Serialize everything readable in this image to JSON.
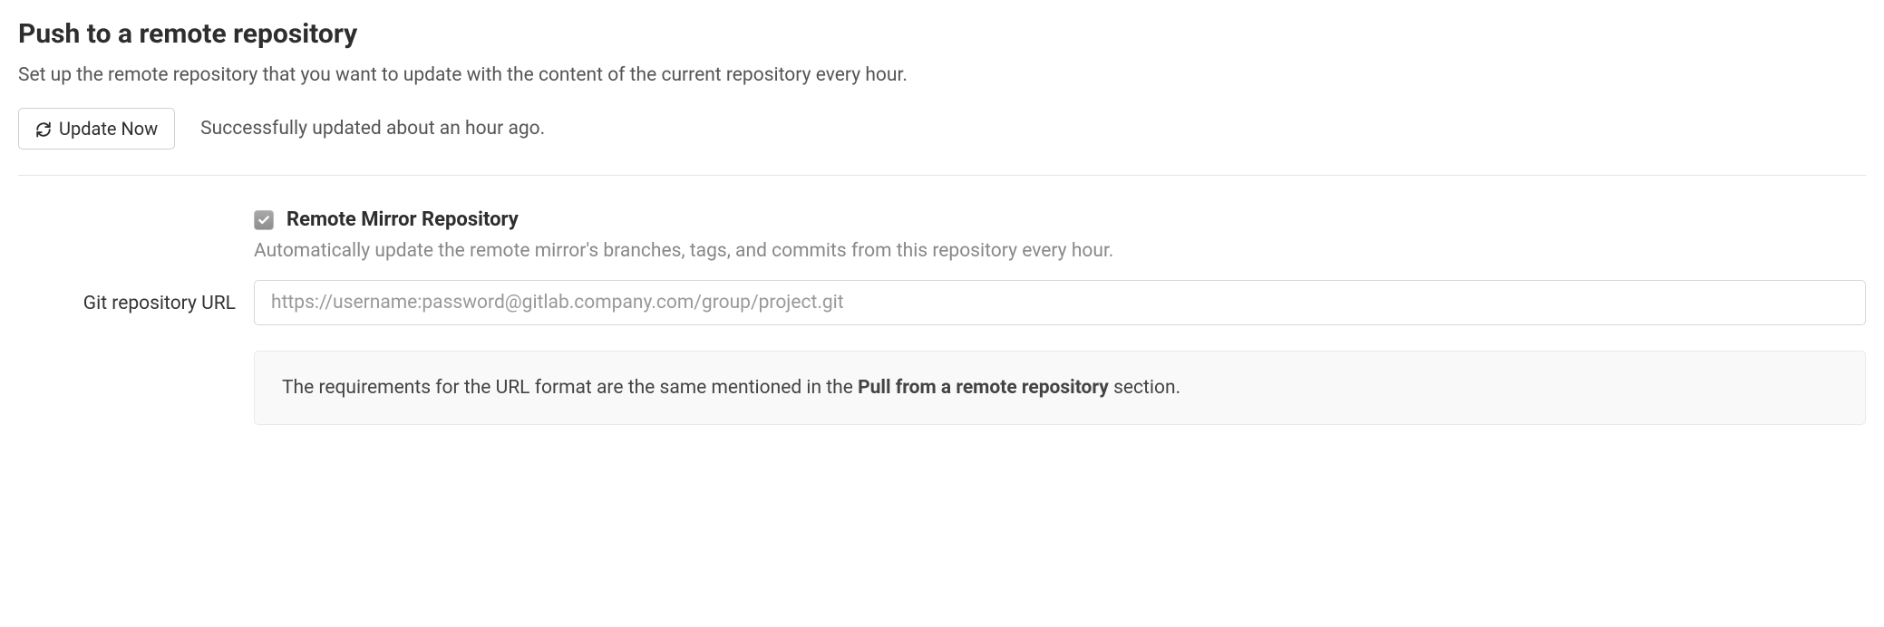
{
  "section": {
    "heading": "Push to a remote repository",
    "description": "Set up the remote repository that you want to update with the content of the current repository every hour."
  },
  "update": {
    "button_label": "Update Now",
    "status": "Successfully updated about an hour ago."
  },
  "mirror": {
    "checkbox_label": "Remote Mirror Repository",
    "help_text": "Automatically update the remote mirror's branches, tags, and commits from this repository every hour.",
    "checked": true
  },
  "url": {
    "label": "Git repository URL",
    "placeholder": "https://username:password@gitlab.company.com/group/project.git",
    "value": ""
  },
  "info": {
    "prefix": "The requirements for the URL format are the same mentioned in the ",
    "bold": "Pull from a remote repository",
    "suffix": " section."
  }
}
